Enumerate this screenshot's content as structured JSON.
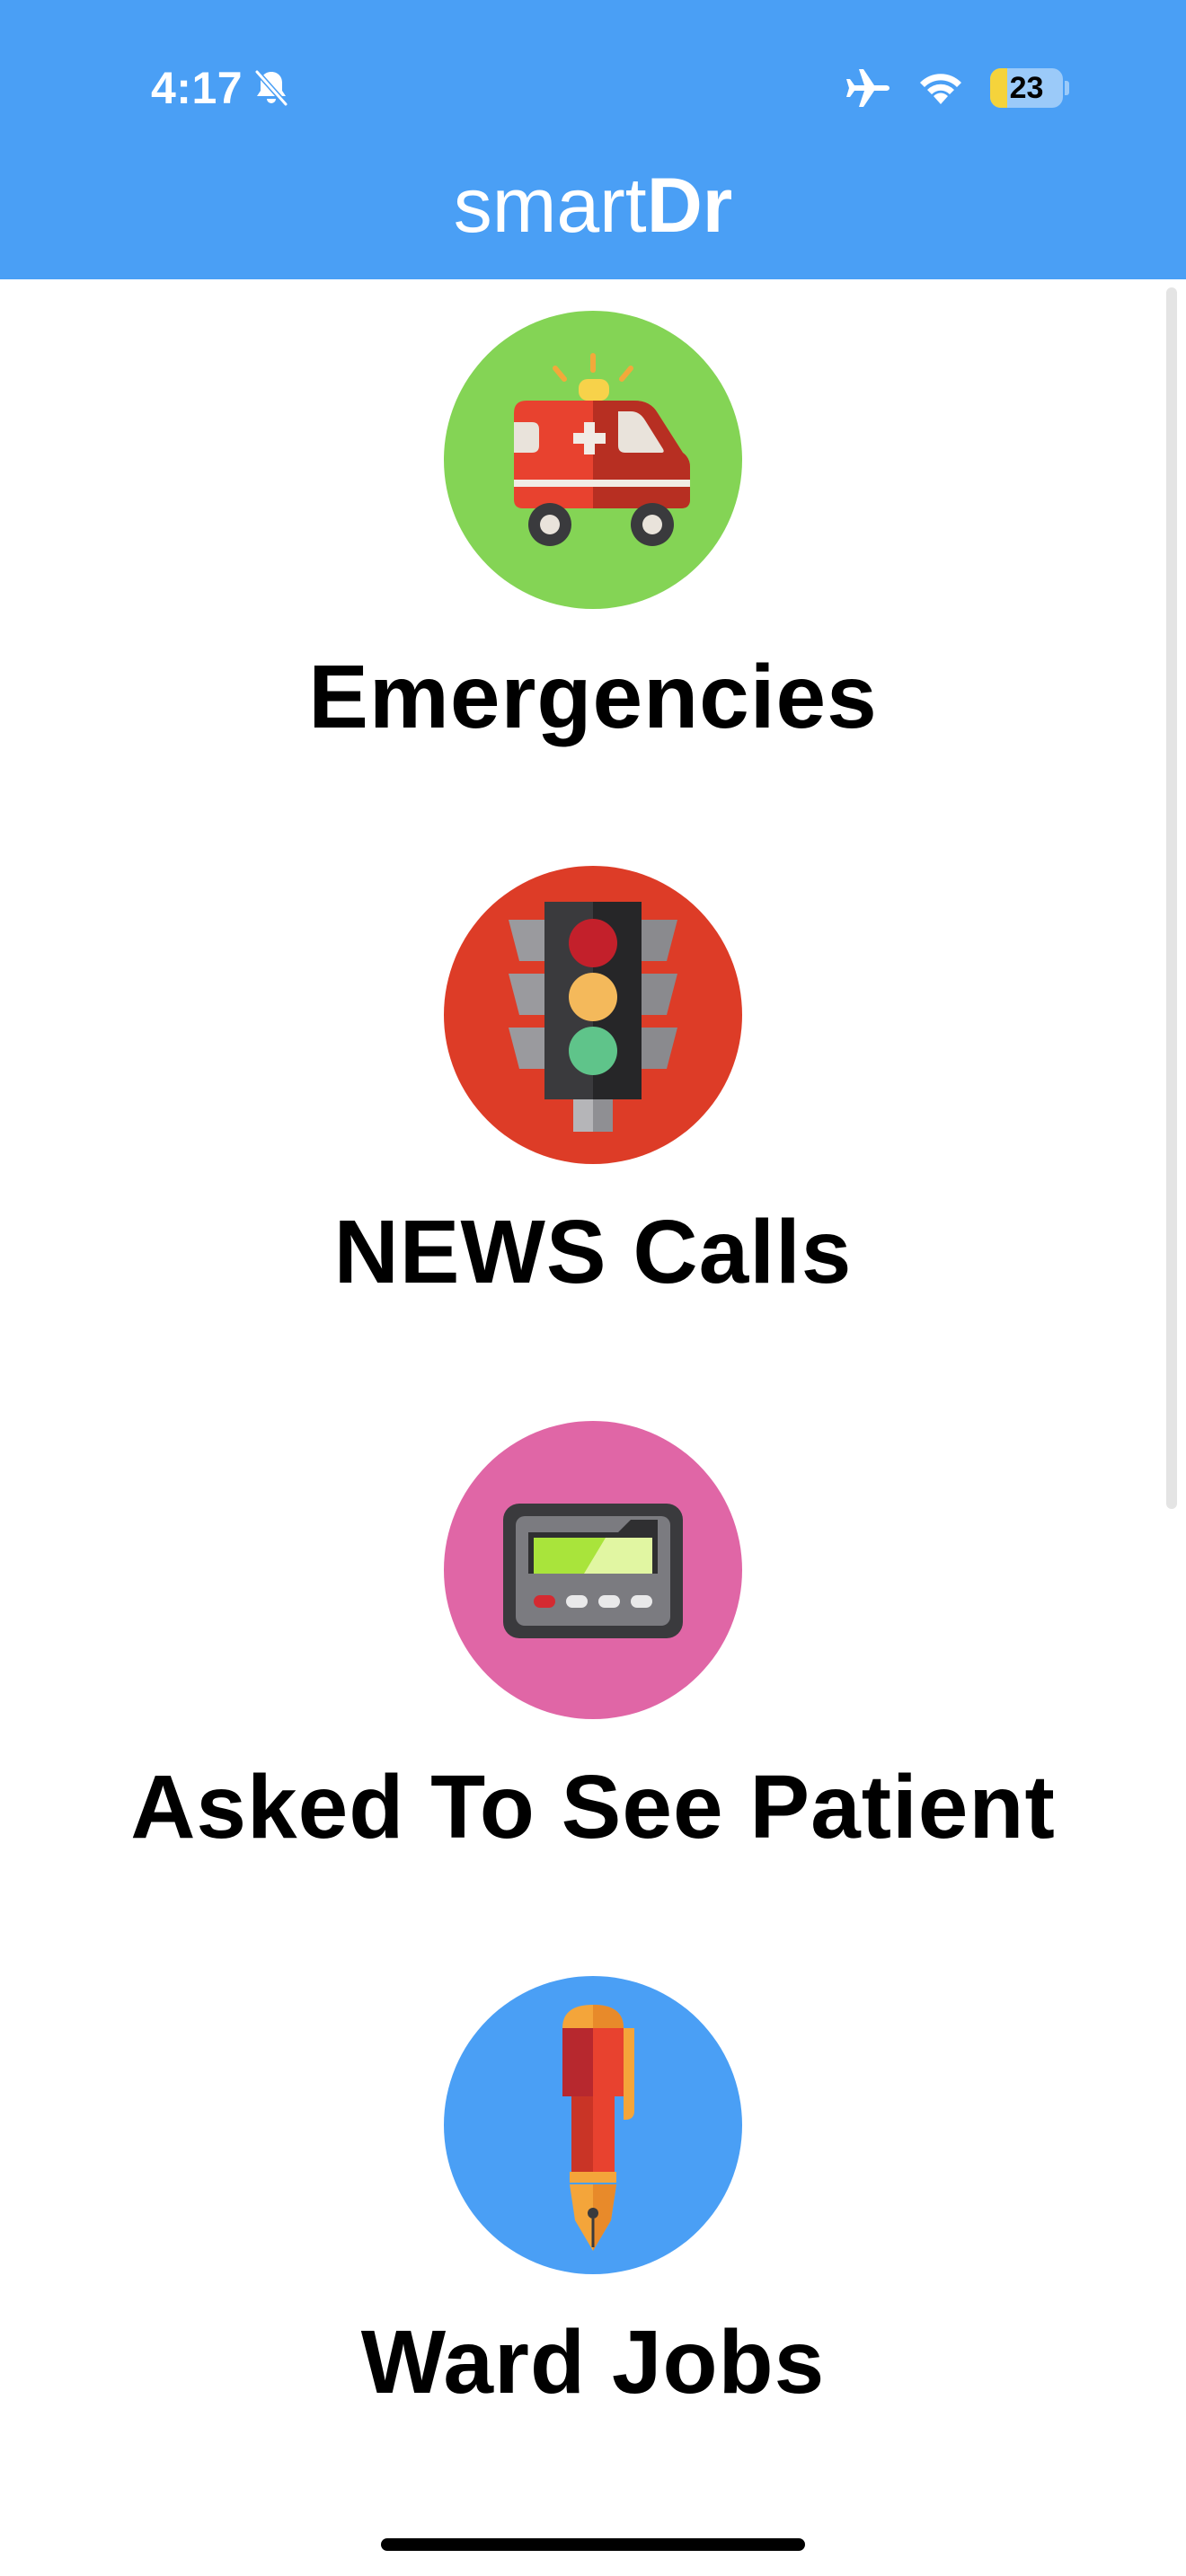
{
  "status_bar": {
    "time": "4:17",
    "battery_level": "23",
    "battery_fraction": 0.23,
    "icons": [
      "bell-slash-icon",
      "airplane-icon",
      "wifi-icon",
      "battery-icon"
    ]
  },
  "header": {
    "title_light": "smart",
    "title_bold": "Dr",
    "background_color": "#4a9ff5"
  },
  "menu": [
    {
      "label": "Emergencies",
      "icon": "ambulance-icon",
      "circle_color": "#84d455"
    },
    {
      "label": "NEWS Calls",
      "icon": "traffic-light-icon",
      "circle_color": "#dd3c27"
    },
    {
      "label": "Asked To See Patient",
      "icon": "pager-icon",
      "circle_color": "#e066a6"
    },
    {
      "label": "Ward Jobs",
      "icon": "fountain-pen-icon",
      "circle_color": "#4a9ff5"
    }
  ]
}
